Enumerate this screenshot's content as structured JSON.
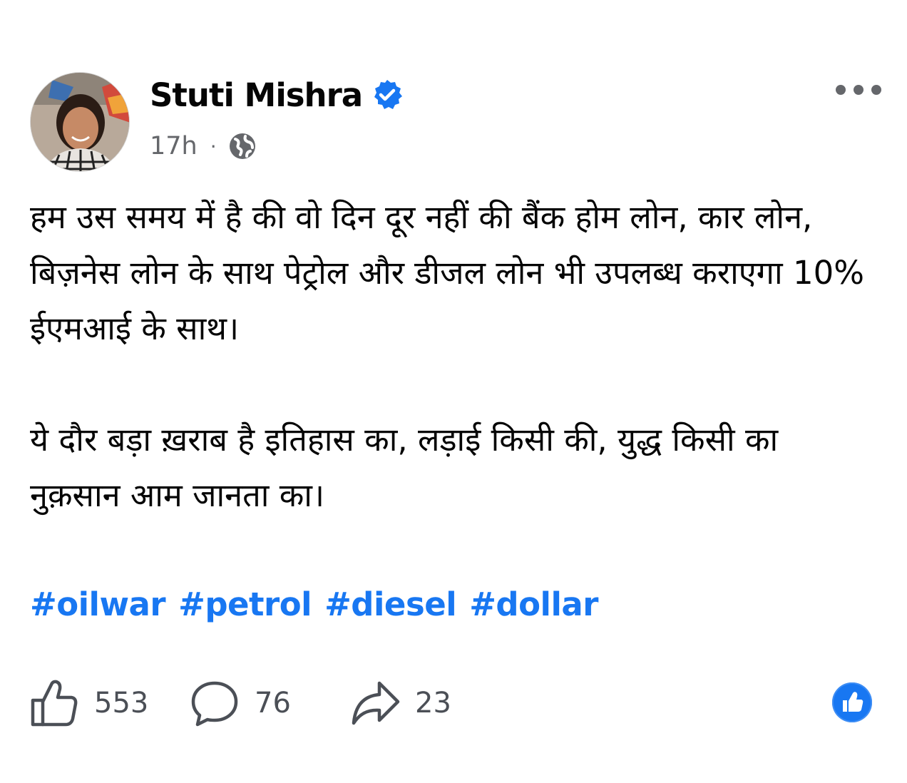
{
  "author": {
    "name": "Stuti Mishra",
    "verified_icon": "verified-badge-icon",
    "timestamp": "17h",
    "separator": "·",
    "audience_icon": "globe-icon"
  },
  "menu": {
    "more_icon": "more-options-icon"
  },
  "post": {
    "paragraph_1": "हम उस समय में है की वो दिन दूर नहीं की बैंक होम लोन, कार लोन, बिज़नेस लोन के साथ पेट्रोल और डीजल लोन भी उपलब्ध कराएगा 10% ईएमआई के साथ।",
    "paragraph_2": "ये दौर बड़ा ख़राब है इतिहास का, लड़ाई किसी की, युद्ध किसी का  नुक़सान आम जानता का।",
    "hashtags": [
      "#oilwar",
      "#petrol",
      "#diesel",
      "#dollar"
    ]
  },
  "actions": {
    "likes": "553",
    "comments": "76",
    "shares": "23"
  },
  "colors": {
    "accent": "#1877f2",
    "text": "#050505",
    "secondary": "#65676b"
  }
}
